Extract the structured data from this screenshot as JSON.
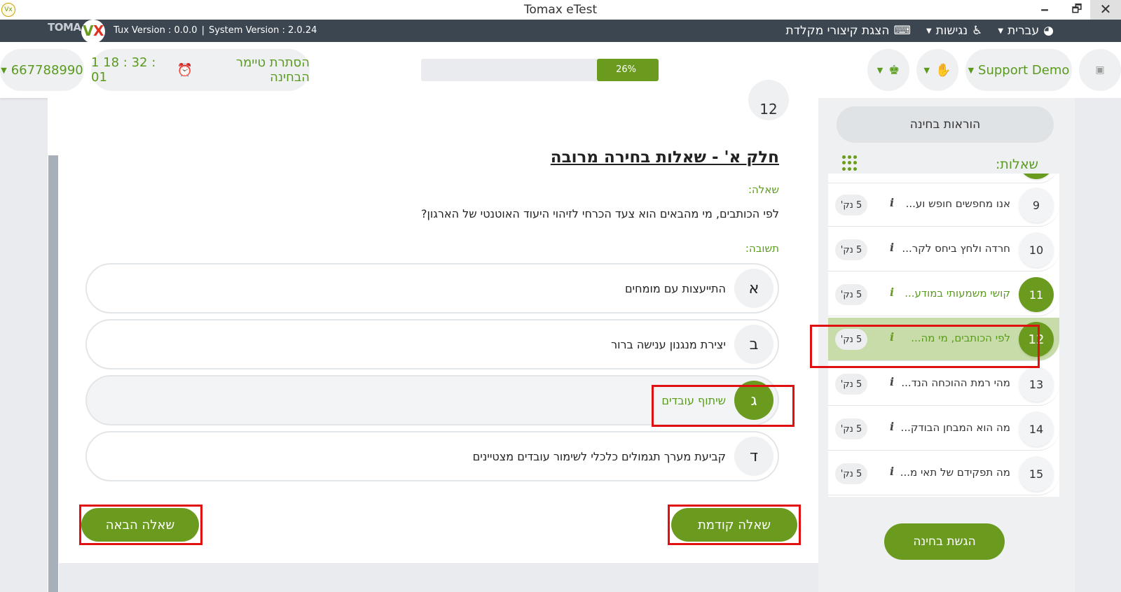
{
  "window": {
    "title": "Tomax eTest",
    "min": "🗕",
    "max": "🗗",
    "close": "✕",
    "app_icon": "Vx"
  },
  "topbar": {
    "brand": "TOMA",
    "logo_v": "V",
    "logo_x": "X",
    "tux_version": "Tux Version : 0.0.0",
    "separator": "|",
    "system_version": "System Version : 2.0.24",
    "language": "עברית",
    "accessibility": "נגישות",
    "shortcuts": "הצגת קיצורי מקלדת"
  },
  "header": {
    "id_number": "667788990",
    "hide_timer": "הסתרת טיימר הבחינה",
    "timer": "1 18 : 32 : 01",
    "progress_label": "26%",
    "progress_value": 26,
    "support": "Support Demo"
  },
  "main": {
    "prev_qnum": "12",
    "part_title": "חלק א' - שאלות בחירה מרובה",
    "question_label": "שאלה:",
    "question_text": "לפי הכותבים, מי מהבאים הוא צעד הכרחי לזיהוי היעוד האוטנטי של הארגון?",
    "answer_label": "תשובה:",
    "options": [
      {
        "letter": "א",
        "text": "התייעצות עם מומחים"
      },
      {
        "letter": "ב",
        "text": "יצירת מנגנון ענישה ברור"
      },
      {
        "letter": "ג",
        "text": "שיתוף עובדים"
      },
      {
        "letter": "ד",
        "text": "קביעת מערך תגמולים כלכלי לשימור עובדים מצטיינים"
      }
    ],
    "selected_option": 2,
    "prev_button": "שאלה קודמת",
    "next_button": "שאלה הבאה"
  },
  "sidebar": {
    "instructions": "הוראות בחינה",
    "questions_label": "שאלות:",
    "info_glyph": "i",
    "questions": [
      {
        "num": "9",
        "text": "אנו מחפשים חופש וע...",
        "points": "5 נק'",
        "state": "normal"
      },
      {
        "num": "10",
        "text": "חרדה ולחץ ביחס לקר...",
        "points": "5 נק'",
        "state": "normal"
      },
      {
        "num": "11",
        "text": "קושי משמעותי במודע...",
        "points": "5 נק'",
        "state": "answered"
      },
      {
        "num": "12",
        "text": "לפי הכותבים, מי מה...",
        "points": "5 נק'",
        "state": "current"
      },
      {
        "num": "13",
        "text": "מהי רמת ההוכחה הנד...",
        "points": "5 נק'",
        "state": "normal"
      },
      {
        "num": "14",
        "text": "מה הוא המבחן הבודק...",
        "points": "5 נק'",
        "state": "normal"
      },
      {
        "num": "15",
        "text": "מה תפקידם של תאי מ...",
        "points": "5 נק'",
        "state": "normal"
      }
    ],
    "submit": "הגשת בחינה"
  },
  "colors": {
    "accent": "#6a9b1f",
    "highlight": "#c7dca8",
    "annotation": "#e01010",
    "dark": "#3c4650"
  }
}
